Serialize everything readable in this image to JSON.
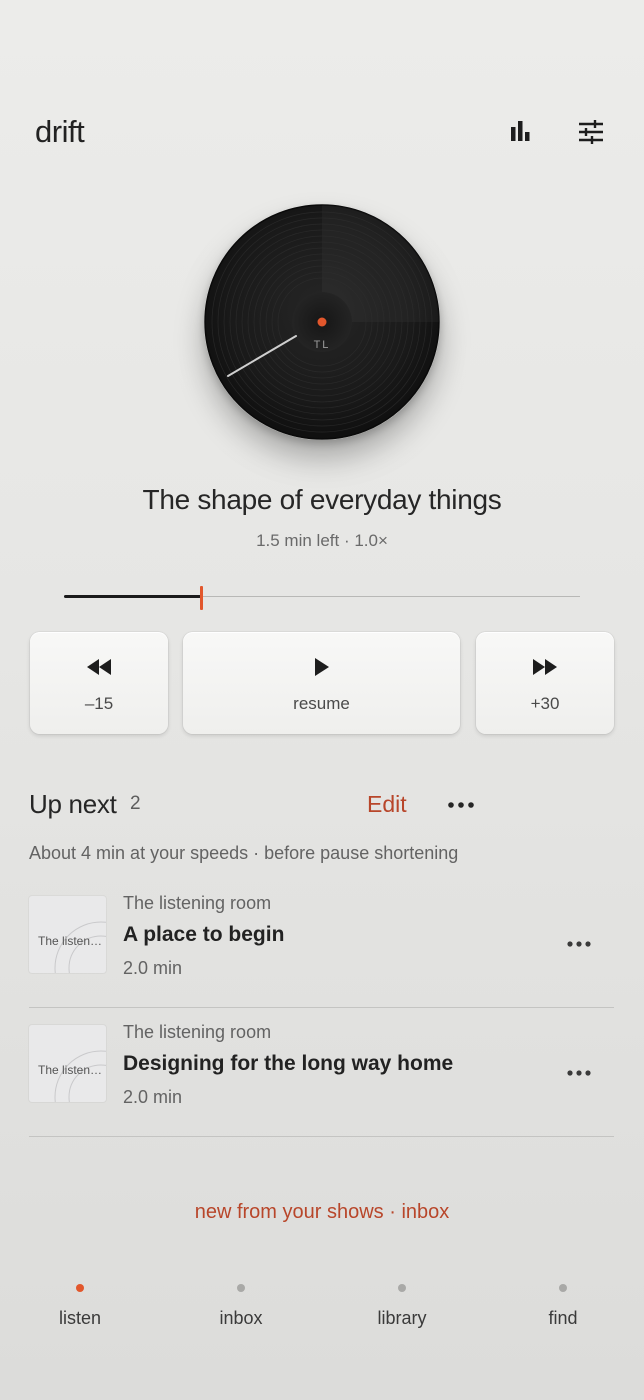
{
  "app": {
    "title": "drift"
  },
  "header": {
    "stats_icon": "bar-chart-icon",
    "settings_icon": "sliders-icon"
  },
  "now_playing": {
    "disc_label": "TL",
    "title": "The shape of everyday things",
    "meta": "1.5 min left · 1.0×",
    "progress": 0.266
  },
  "controls": {
    "rewind_label": "–15",
    "play_label": "resume",
    "forward_label": "+30"
  },
  "up_next": {
    "title": "Up next",
    "count": "2",
    "edit_label": "Edit",
    "summary": "About 4 min at your speeds · before pause shortening",
    "items": [
      {
        "show": "The listening room",
        "title": "A place to begin",
        "duration": "2.0 min",
        "art_text": "The listening room"
      },
      {
        "show": "The listening room",
        "title": "Designing for the long way home",
        "duration": "2.0 min",
        "art_text": "The listening room"
      }
    ]
  },
  "inbox_link": "new from your shows · inbox",
  "tabs": [
    {
      "label": "listen",
      "active": true
    },
    {
      "label": "inbox",
      "active": false
    },
    {
      "label": "library",
      "active": false
    },
    {
      "label": "find",
      "active": false
    }
  ],
  "colors": {
    "accent": "#e2572c",
    "link": "#b8462a",
    "background": "#e8e8e6",
    "disc": "#161616"
  }
}
